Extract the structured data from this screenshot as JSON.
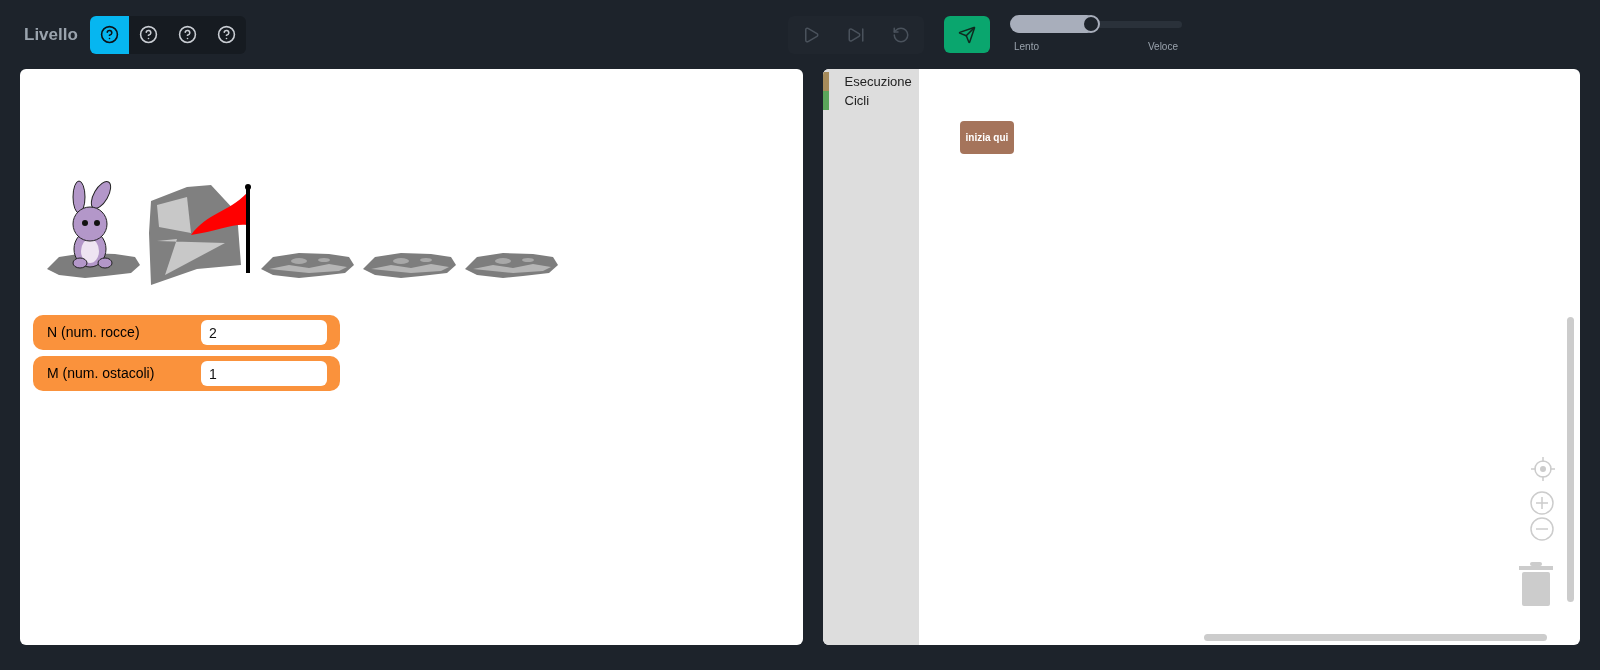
{
  "header": {
    "title": "Livello",
    "levels": [
      {
        "selected": true
      },
      {
        "selected": false
      },
      {
        "selected": false
      },
      {
        "selected": false
      }
    ]
  },
  "controls": [
    {
      "kind": "play",
      "disabled": true
    },
    {
      "kind": "step",
      "disabled": true
    },
    {
      "kind": "reset",
      "disabled": true
    }
  ],
  "submit": {
    "disabled": false
  },
  "speed": {
    "level": 0.5,
    "min_label": "Lento",
    "max_label": "Veloce"
  },
  "board": {
    "cells": [
      {
        "kind": "bunny"
      },
      {
        "kind": "rock"
      },
      {
        "kind": "slab"
      },
      {
        "kind": "slab"
      },
      {
        "kind": "slab"
      }
    ]
  },
  "parameters": [
    {
      "label": "N (num. rocce)",
      "value": "2"
    },
    {
      "label": "M (num. ostacoli)",
      "value": "1"
    }
  ],
  "toolbox": {
    "categories": [
      {
        "label": "Esecuzione",
        "color": "#a68b5b"
      },
      {
        "label": "Cicli",
        "color": "#5ba55b"
      }
    ]
  },
  "workspace": {
    "blocks": [
      {
        "label": "inizia qui",
        "color": "#a5745b"
      }
    ]
  }
}
